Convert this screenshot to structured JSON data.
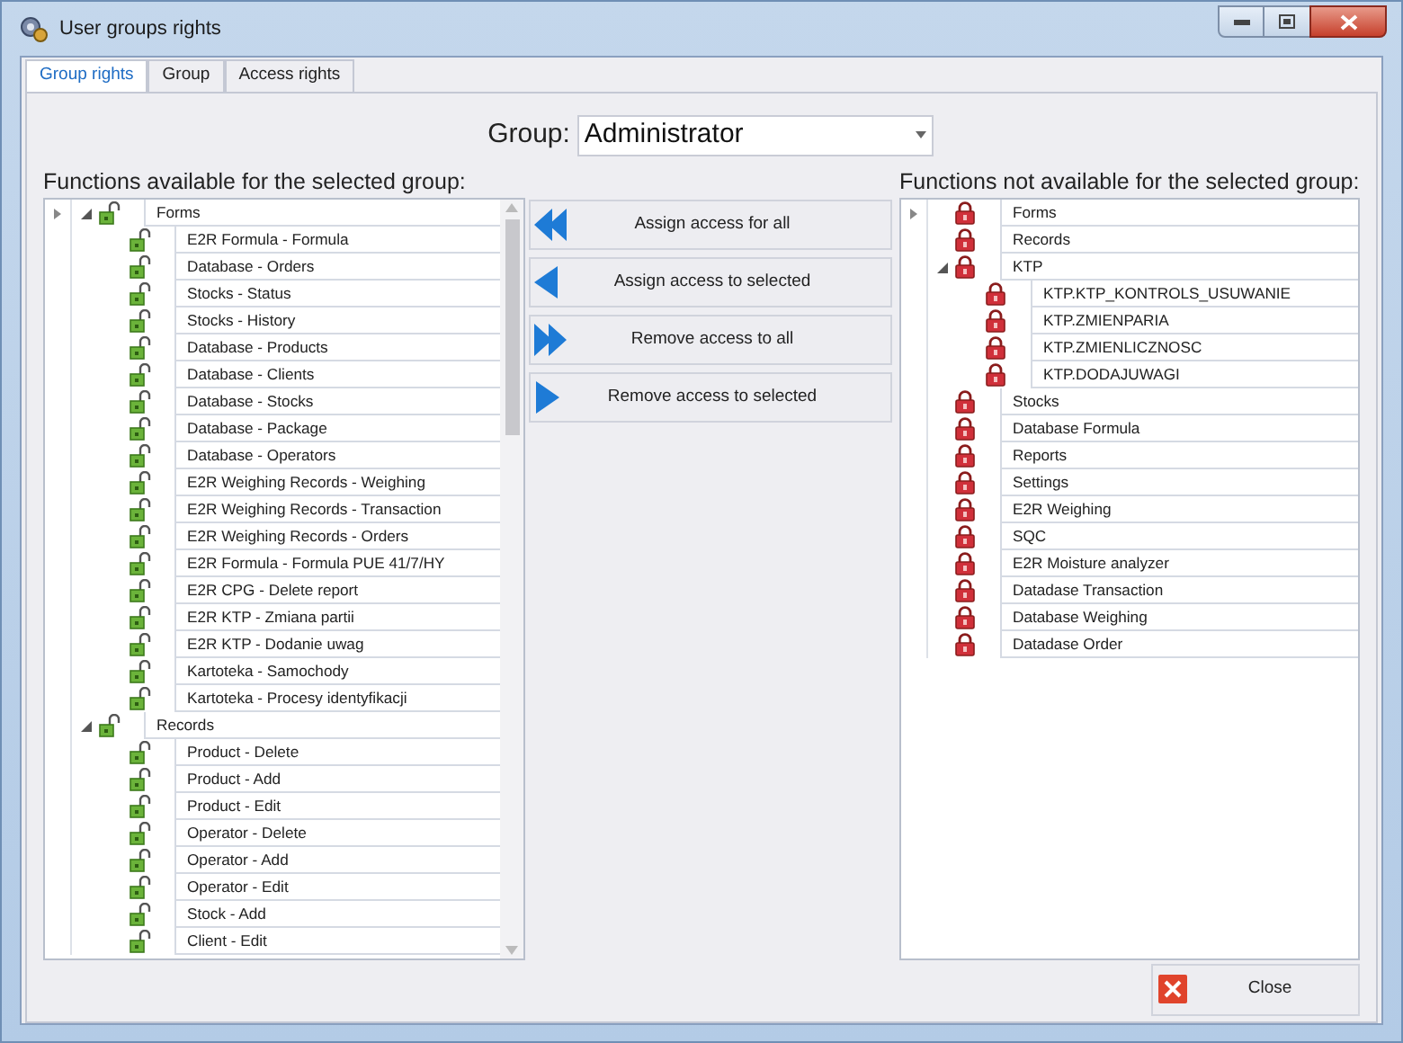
{
  "window": {
    "title": "User groups rights"
  },
  "tabs": [
    {
      "label": "Group rights",
      "selected": true
    },
    {
      "label": "Group",
      "selected": false
    },
    {
      "label": "Access rights",
      "selected": false
    }
  ],
  "group": {
    "label": "Group:",
    "value": "Administrator"
  },
  "available": {
    "heading": "Functions available for the selected group:",
    "items": [
      {
        "label": "Forms",
        "current": true,
        "expanded": true,
        "children": [
          {
            "label": "E2R Formula - Formula"
          },
          {
            "label": "Database -  Orders"
          },
          {
            "label": "Stocks - Status"
          },
          {
            "label": "Stocks - History"
          },
          {
            "label": "Database - Products"
          },
          {
            "label": "Database - Clients"
          },
          {
            "label": "Database - Stocks"
          },
          {
            "label": "Database - Package"
          },
          {
            "label": "Database - Operators"
          },
          {
            "label": "E2R Weighing Records - Weighing"
          },
          {
            "label": "E2R Weighing Records - Transaction"
          },
          {
            "label": "E2R Weighing Records - Orders"
          },
          {
            "label": "E2R Formula - Formula PUE 41/7/HY"
          },
          {
            "label": "E2R CPG - Delete report"
          },
          {
            "label": "E2R KTP - Zmiana partii"
          },
          {
            "label": "E2R KTP - Dodanie uwag"
          },
          {
            "label": "Kartoteka - Samochody"
          },
          {
            "label": "Kartoteka - Procesy identyfikacji"
          }
        ]
      },
      {
        "label": "Records",
        "current": false,
        "expanded": true,
        "children": [
          {
            "label": "Product - Delete"
          },
          {
            "label": "Product - Add"
          },
          {
            "label": "Product - Edit"
          },
          {
            "label": "Operator - Delete"
          },
          {
            "label": "Operator - Add"
          },
          {
            "label": "Operator - Edit"
          },
          {
            "label": "Stock - Add"
          },
          {
            "label": "Client - Edit"
          }
        ]
      }
    ]
  },
  "actions": [
    {
      "label": "Assign access for all",
      "kind": "assign-all"
    },
    {
      "label": "Assign access to selected",
      "kind": "assign"
    },
    {
      "label": "Remove access to all",
      "kind": "remove-all"
    },
    {
      "label": "Remove access to selected",
      "kind": "remove"
    }
  ],
  "unavailable": {
    "heading": "Functions not available for the selected group:",
    "items": [
      {
        "label": "Forms",
        "current": true
      },
      {
        "label": "Records",
        "current": false
      },
      {
        "label": "KTP",
        "current": false,
        "expanded": true,
        "children": [
          {
            "label": "KTP.KTP_KONTROLS_USUWANIE"
          },
          {
            "label": "KTP.ZMIENPARIA"
          },
          {
            "label": "KTP.ZMIENLICZNOSC"
          },
          {
            "label": "KTP.DODAJUWAGI"
          }
        ]
      },
      {
        "label": "Stocks",
        "current": false
      },
      {
        "label": "Database Formula",
        "current": false
      },
      {
        "label": "Reports",
        "current": false
      },
      {
        "label": "Settings",
        "current": false
      },
      {
        "label": "E2R Weighing",
        "current": false
      },
      {
        "label": "SQC",
        "current": false
      },
      {
        "label": "E2R Moisture analyzer",
        "current": false
      },
      {
        "label": "Datadase Transaction",
        "current": false
      },
      {
        "label": "Database Weighing",
        "current": false
      },
      {
        "label": "Datadase Order",
        "current": false
      }
    ]
  },
  "close_button": {
    "label": "Close"
  }
}
